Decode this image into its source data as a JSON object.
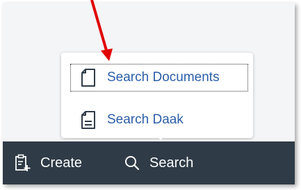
{
  "menu": {
    "items": [
      {
        "label": "Search Documents",
        "icon": "document-icon"
      },
      {
        "label": "Search Daak",
        "icon": "document-lines-icon"
      }
    ]
  },
  "toolbar": {
    "create_label": "Create",
    "search_label": "Search"
  },
  "colors": {
    "toolbar_bg": "#2f3b47",
    "menu_text": "#2b5ea8",
    "annotation_arrow": "#e00000"
  }
}
